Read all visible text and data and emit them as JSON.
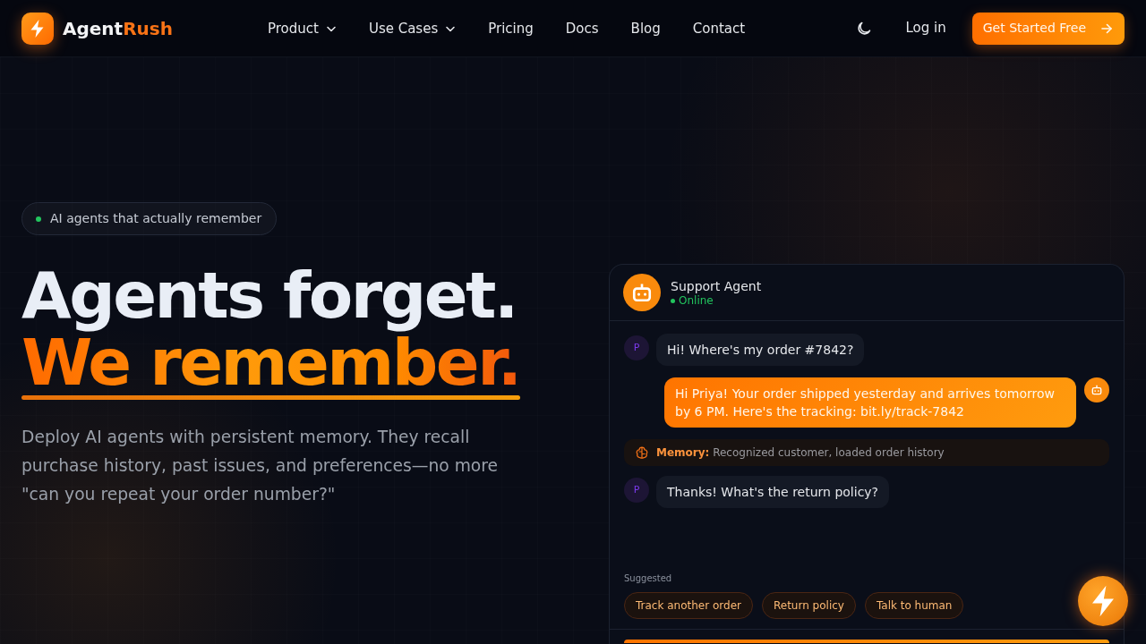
{
  "nav": {
    "brand": {
      "part_1": "Agent",
      "part_2": "Rush"
    },
    "links": [
      {
        "label": "Product",
        "dropdown": true
      },
      {
        "label": "Use Cases",
        "dropdown": true
      },
      {
        "label": "Pricing",
        "dropdown": false
      },
      {
        "label": "Docs",
        "dropdown": false
      },
      {
        "label": "Blog",
        "dropdown": false
      },
      {
        "label": "Contact",
        "dropdown": false
      }
    ],
    "login": "Log in",
    "cta": "Get Started Free"
  },
  "hero": {
    "badge": "AI agents that actually remember",
    "title_line_1": "Agents forget.",
    "title_line_2": "We remember.",
    "description": "Deploy AI agents with persistent memory. They recall purchase history, past issues, and preferences—no more \"can you repeat your order number?\""
  },
  "chat": {
    "agent_name": "Support Agent",
    "status": {
      "text": "Online",
      "online": true
    },
    "messages": [
      {
        "kind": "user",
        "avatar": "P",
        "text": "Hi! Where's my order #7842?"
      },
      {
        "kind": "agent",
        "text": "Hi Priya! Your order shipped yesterday and arrives tomorrow by 6 PM. Here's the tracking: bit.ly/track-7842"
      },
      {
        "kind": "memory",
        "text": "**Memory:** Recognized customer, loaded order history"
      },
      {
        "kind": "user",
        "avatar": "P",
        "text": "Thanks! What's the return policy?"
      }
    ],
    "suggested_label": "Suggested",
    "suggestions": [
      "Track another order",
      "Return policy",
      "Talk to human"
    ]
  }
}
